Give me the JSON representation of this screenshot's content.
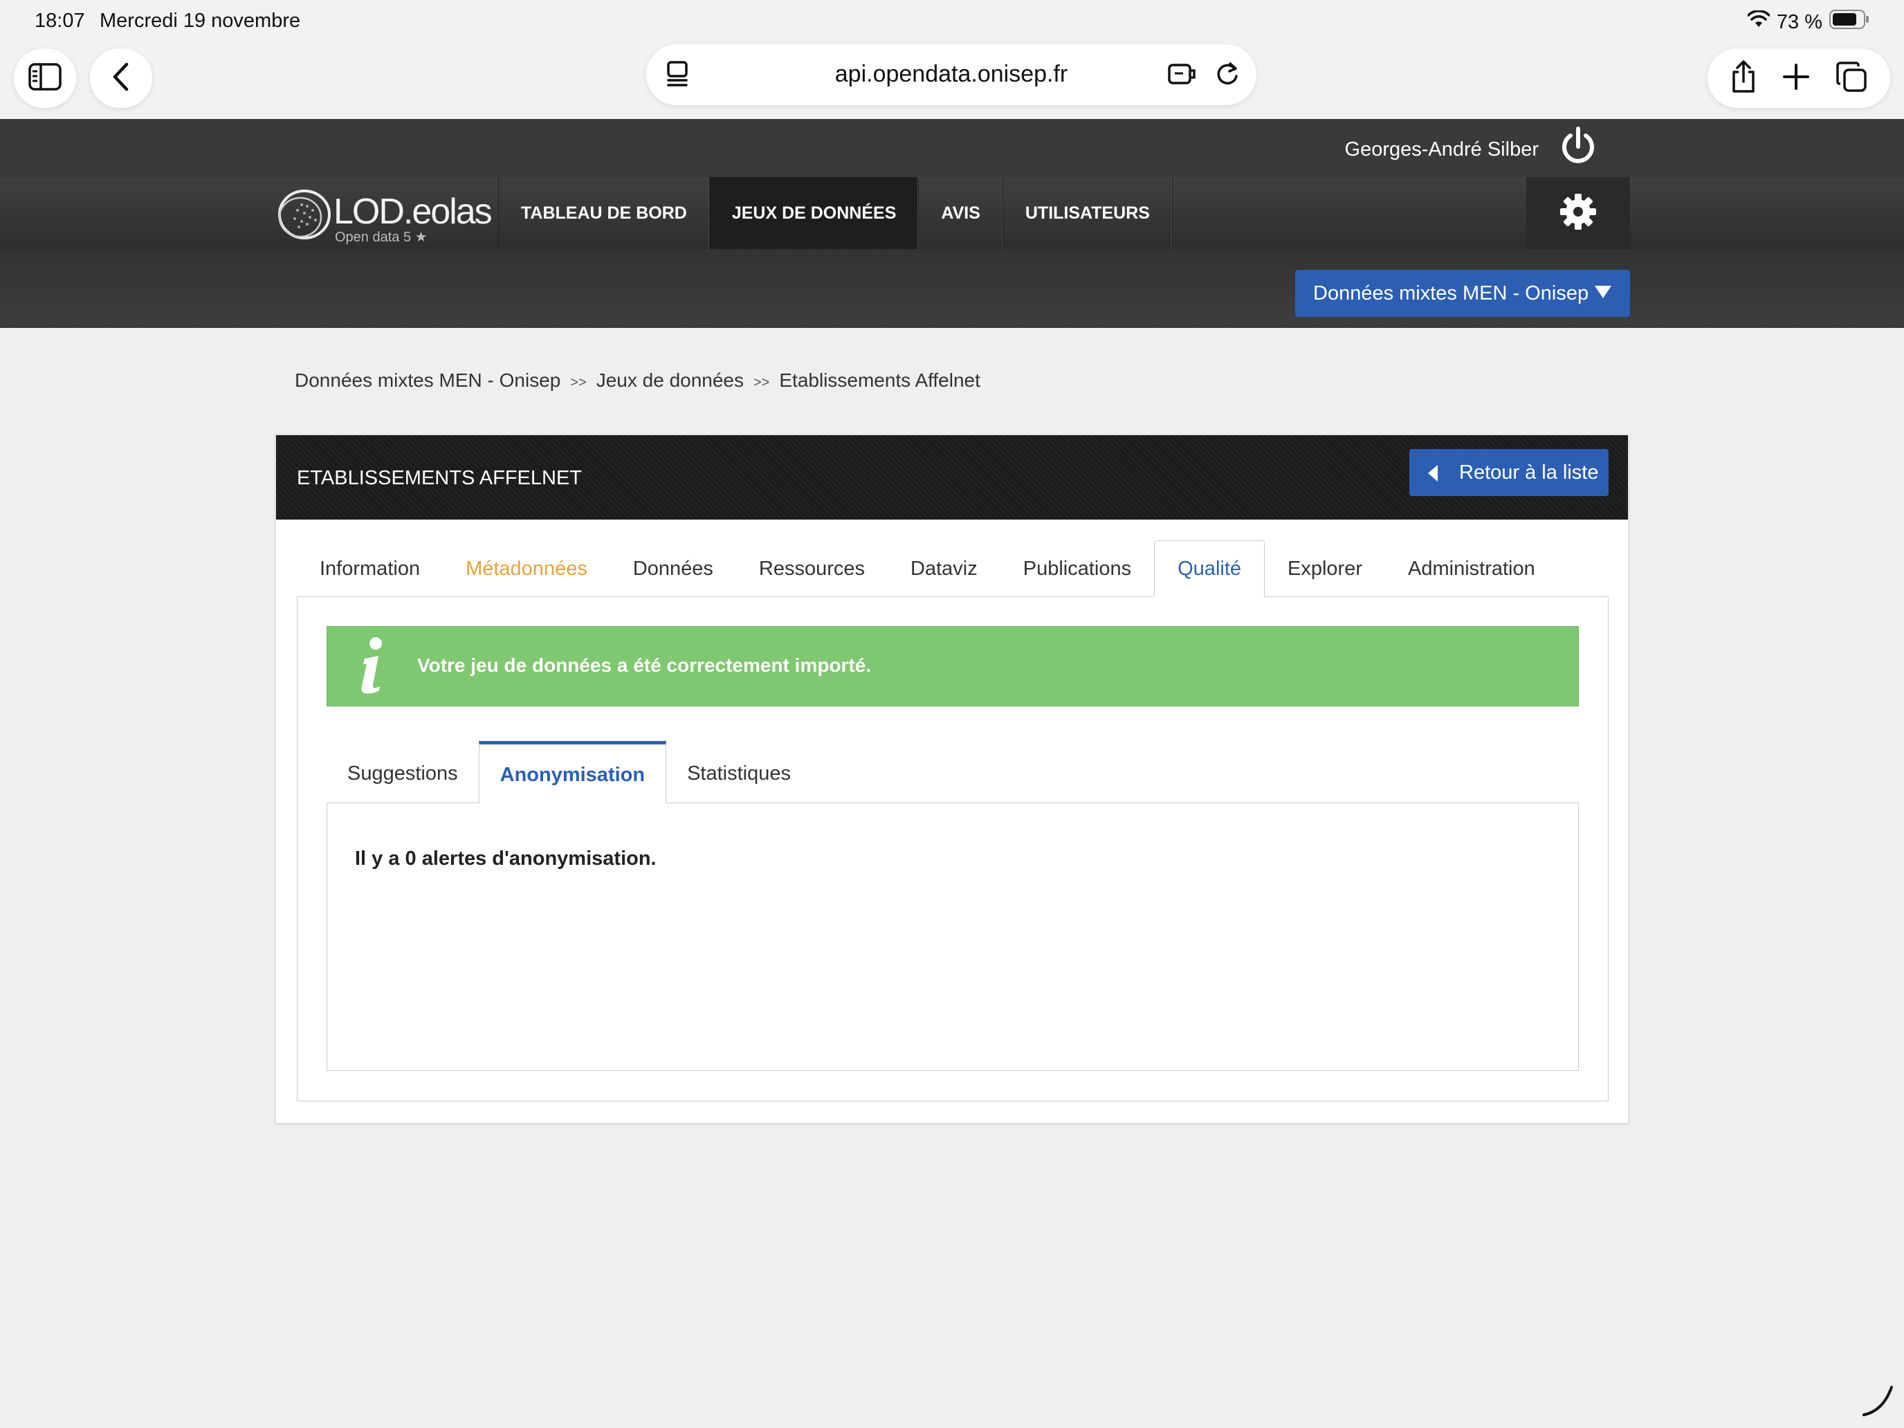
{
  "status_bar": {
    "time": "18:07",
    "date": "Mercredi 19 novembre",
    "battery": "73 %"
  },
  "browser": {
    "url": "api.opendata.onisep.fr"
  },
  "header": {
    "user_name": "Georges-André Silber",
    "logo": {
      "name": "LOD.eolas",
      "tagline": "Open data 5 ★"
    },
    "nav": [
      {
        "label": "TABLEAU DE BORD"
      },
      {
        "label": "JEUX DE DONNÉES"
      },
      {
        "label": "AVIS"
      },
      {
        "label": "UTILISATEURS"
      }
    ],
    "org_select": "Données mixtes MEN - Onisep"
  },
  "breadcrumb": {
    "items": [
      "Données mixtes MEN - Onisep",
      "Jeux de données",
      "Etablissements Affelnet"
    ],
    "separator": ">>"
  },
  "panel": {
    "title": "ETABLISSEMENTS AFFELNET",
    "back_label": "Retour à la liste",
    "tabs": [
      {
        "label": "Information"
      },
      {
        "label": "Métadonnées"
      },
      {
        "label": "Données"
      },
      {
        "label": "Ressources"
      },
      {
        "label": "Dataviz"
      },
      {
        "label": "Publications"
      },
      {
        "label": "Qualité"
      },
      {
        "label": "Explorer"
      },
      {
        "label": "Administration"
      }
    ],
    "alert_message": "Votre jeu de données a été correctement importé.",
    "subtabs": [
      {
        "label": "Suggestions"
      },
      {
        "label": "Anonymisation"
      },
      {
        "label": "Statistiques"
      }
    ],
    "content_text": "Il y a 0 alertes d'anonymisation."
  },
  "colors": {
    "primary_blue": "#2c5fb4",
    "success_green": "#7fc771",
    "warning_orange": "#e8a33c",
    "header_dark": "#3a3a3a"
  }
}
